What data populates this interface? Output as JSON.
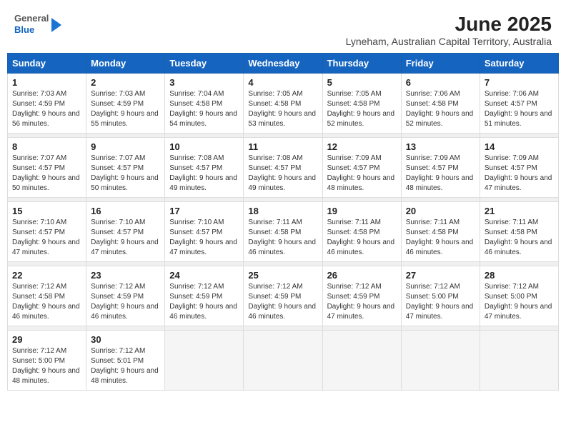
{
  "header": {
    "logo_line1": "General",
    "logo_line2": "Blue",
    "title": "June 2025",
    "subtitle": "Lyneham, Australian Capital Territory, Australia"
  },
  "weekdays": [
    "Sunday",
    "Monday",
    "Tuesday",
    "Wednesday",
    "Thursday",
    "Friday",
    "Saturday"
  ],
  "weeks": [
    [
      {
        "day": 1,
        "sunrise": "7:03 AM",
        "sunset": "4:59 PM",
        "daylight": "9 hours and 56 minutes"
      },
      {
        "day": 2,
        "sunrise": "7:03 AM",
        "sunset": "4:59 PM",
        "daylight": "9 hours and 55 minutes"
      },
      {
        "day": 3,
        "sunrise": "7:04 AM",
        "sunset": "4:58 PM",
        "daylight": "9 hours and 54 minutes"
      },
      {
        "day": 4,
        "sunrise": "7:05 AM",
        "sunset": "4:58 PM",
        "daylight": "9 hours and 53 minutes"
      },
      {
        "day": 5,
        "sunrise": "7:05 AM",
        "sunset": "4:58 PM",
        "daylight": "9 hours and 52 minutes"
      },
      {
        "day": 6,
        "sunrise": "7:06 AM",
        "sunset": "4:58 PM",
        "daylight": "9 hours and 52 minutes"
      },
      {
        "day": 7,
        "sunrise": "7:06 AM",
        "sunset": "4:57 PM",
        "daylight": "9 hours and 51 minutes"
      }
    ],
    [
      {
        "day": 8,
        "sunrise": "7:07 AM",
        "sunset": "4:57 PM",
        "daylight": "9 hours and 50 minutes"
      },
      {
        "day": 9,
        "sunrise": "7:07 AM",
        "sunset": "4:57 PM",
        "daylight": "9 hours and 50 minutes"
      },
      {
        "day": 10,
        "sunrise": "7:08 AM",
        "sunset": "4:57 PM",
        "daylight": "9 hours and 49 minutes"
      },
      {
        "day": 11,
        "sunrise": "7:08 AM",
        "sunset": "4:57 PM",
        "daylight": "9 hours and 49 minutes"
      },
      {
        "day": 12,
        "sunrise": "7:09 AM",
        "sunset": "4:57 PM",
        "daylight": "9 hours and 48 minutes"
      },
      {
        "day": 13,
        "sunrise": "7:09 AM",
        "sunset": "4:57 PM",
        "daylight": "9 hours and 48 minutes"
      },
      {
        "day": 14,
        "sunrise": "7:09 AM",
        "sunset": "4:57 PM",
        "daylight": "9 hours and 47 minutes"
      }
    ],
    [
      {
        "day": 15,
        "sunrise": "7:10 AM",
        "sunset": "4:57 PM",
        "daylight": "9 hours and 47 minutes"
      },
      {
        "day": 16,
        "sunrise": "7:10 AM",
        "sunset": "4:57 PM",
        "daylight": "9 hours and 47 minutes"
      },
      {
        "day": 17,
        "sunrise": "7:10 AM",
        "sunset": "4:57 PM",
        "daylight": "9 hours and 47 minutes"
      },
      {
        "day": 18,
        "sunrise": "7:11 AM",
        "sunset": "4:58 PM",
        "daylight": "9 hours and 46 minutes"
      },
      {
        "day": 19,
        "sunrise": "7:11 AM",
        "sunset": "4:58 PM",
        "daylight": "9 hours and 46 minutes"
      },
      {
        "day": 20,
        "sunrise": "7:11 AM",
        "sunset": "4:58 PM",
        "daylight": "9 hours and 46 minutes"
      },
      {
        "day": 21,
        "sunrise": "7:11 AM",
        "sunset": "4:58 PM",
        "daylight": "9 hours and 46 minutes"
      }
    ],
    [
      {
        "day": 22,
        "sunrise": "7:12 AM",
        "sunset": "4:58 PM",
        "daylight": "9 hours and 46 minutes"
      },
      {
        "day": 23,
        "sunrise": "7:12 AM",
        "sunset": "4:59 PM",
        "daylight": "9 hours and 46 minutes"
      },
      {
        "day": 24,
        "sunrise": "7:12 AM",
        "sunset": "4:59 PM",
        "daylight": "9 hours and 46 minutes"
      },
      {
        "day": 25,
        "sunrise": "7:12 AM",
        "sunset": "4:59 PM",
        "daylight": "9 hours and 46 minutes"
      },
      {
        "day": 26,
        "sunrise": "7:12 AM",
        "sunset": "4:59 PM",
        "daylight": "9 hours and 47 minutes"
      },
      {
        "day": 27,
        "sunrise": "7:12 AM",
        "sunset": "5:00 PM",
        "daylight": "9 hours and 47 minutes"
      },
      {
        "day": 28,
        "sunrise": "7:12 AM",
        "sunset": "5:00 PM",
        "daylight": "9 hours and 47 minutes"
      }
    ],
    [
      {
        "day": 29,
        "sunrise": "7:12 AM",
        "sunset": "5:00 PM",
        "daylight": "9 hours and 48 minutes"
      },
      {
        "day": 30,
        "sunrise": "7:12 AM",
        "sunset": "5:01 PM",
        "daylight": "9 hours and 48 minutes"
      },
      null,
      null,
      null,
      null,
      null
    ]
  ]
}
